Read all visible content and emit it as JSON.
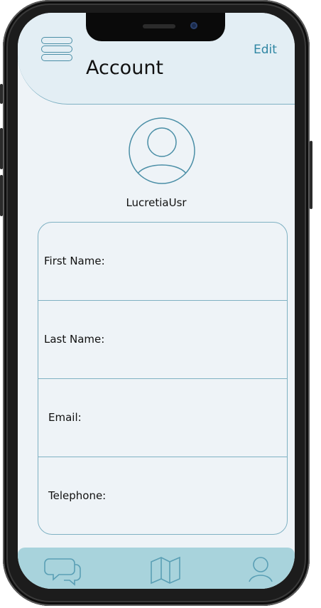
{
  "header": {
    "title": "Account",
    "edit_label": "Edit"
  },
  "profile": {
    "username": "LucretiaUsr",
    "avatar_icon": "user-circle-icon"
  },
  "fields": [
    {
      "label": "First Name:"
    },
    {
      "label": "Last Name:"
    },
    {
      "label": "Email:"
    },
    {
      "label": "Telephone:"
    }
  ],
  "tabbar": {
    "items": [
      {
        "icon": "chat-icon"
      },
      {
        "icon": "map-icon"
      },
      {
        "icon": "profile-icon"
      }
    ]
  },
  "colors": {
    "accent": "#2f86a3",
    "outline": "#7fb1c3",
    "tabbar_bg": "#a8d3dc",
    "screen_bg": "#eef3f7"
  }
}
